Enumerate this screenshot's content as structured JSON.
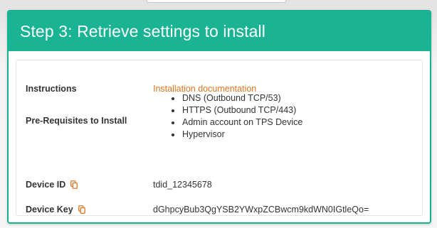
{
  "step": {
    "title": "Step 3: Retrieve settings to install"
  },
  "rows": {
    "instructions": {
      "label": "Instructions",
      "link_text": "Installation documentation"
    },
    "prerequisites": {
      "label": "Pre-Requisites to Install",
      "items": [
        "DNS (Outbound TCP/53)",
        "HTTPS (Outbound TCP/443)",
        "Admin account on TPS Device",
        "Hypervisor"
      ]
    },
    "device_id": {
      "label": "Device ID",
      "icon": "copy-icon",
      "value": "tdid_12345678"
    },
    "device_key": {
      "label": "Device Key",
      "icon": "copy-icon",
      "value": "dGhpcyBub3QgYSB2YWxpZCBwcm9kdWN0IGtleQo="
    }
  },
  "colors": {
    "header": "#1ab394",
    "link": "#e0731d",
    "copy_icon": "#e0731d"
  }
}
